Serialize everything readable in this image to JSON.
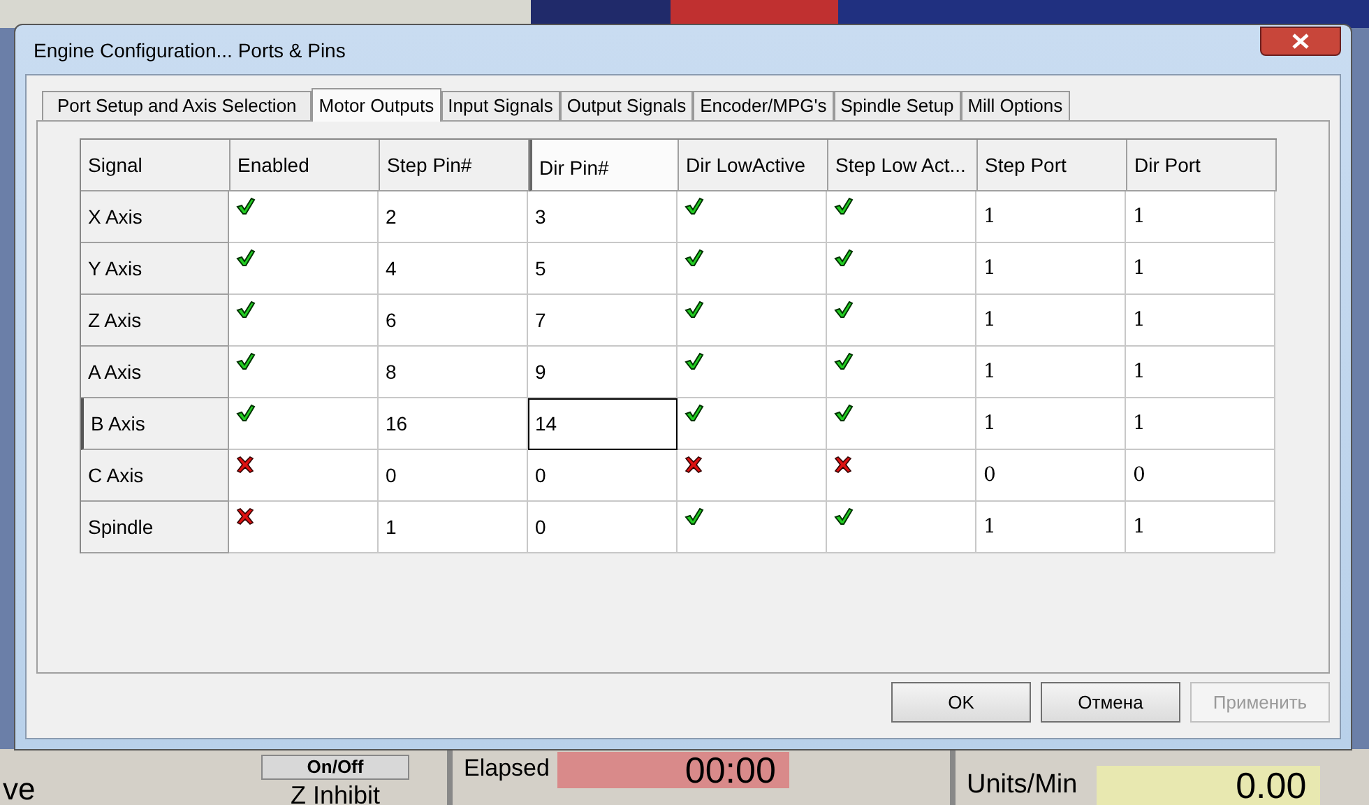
{
  "background": {
    "left_text": "ve",
    "onoff_button": "On/Off",
    "z_inhibit": "Z Inhibit",
    "elapsed_label": "Elapsed",
    "elapsed_value": "00:00",
    "units_label": "Units/Min",
    "units_value": "0.00"
  },
  "window": {
    "title": "Engine Configuration... Ports & Pins"
  },
  "tabs": [
    {
      "label": "Port Setup and Axis Selection",
      "selected": false
    },
    {
      "label": "Motor Outputs",
      "selected": true
    },
    {
      "label": "Input Signals",
      "selected": false
    },
    {
      "label": "Output Signals",
      "selected": false
    },
    {
      "label": "Encoder/MPG's",
      "selected": false
    },
    {
      "label": "Spindle Setup",
      "selected": false
    },
    {
      "label": "Mill Options",
      "selected": false
    }
  ],
  "table": {
    "columns": [
      {
        "label": "Signal",
        "selected": false
      },
      {
        "label": "Enabled",
        "selected": false
      },
      {
        "label": "Step Pin#",
        "selected": false
      },
      {
        "label": "Dir Pin#",
        "selected": true
      },
      {
        "label": "Dir LowActive",
        "selected": false
      },
      {
        "label": "Step Low Act...",
        "selected": false
      },
      {
        "label": "Step Port",
        "selected": false
      },
      {
        "label": "Dir Port",
        "selected": false
      }
    ],
    "rows": [
      {
        "signal": "X Axis",
        "enabled": true,
        "step_pin": "2",
        "dir_pin": "3",
        "dir_low_active": true,
        "step_low_active": true,
        "step_port": "1",
        "dir_port": "1",
        "selected": false
      },
      {
        "signal": "Y Axis",
        "enabled": true,
        "step_pin": "4",
        "dir_pin": "5",
        "dir_low_active": true,
        "step_low_active": true,
        "step_port": "1",
        "dir_port": "1",
        "selected": false
      },
      {
        "signal": "Z Axis",
        "enabled": true,
        "step_pin": "6",
        "dir_pin": "7",
        "dir_low_active": true,
        "step_low_active": true,
        "step_port": "1",
        "dir_port": "1",
        "selected": false
      },
      {
        "signal": "A Axis",
        "enabled": true,
        "step_pin": "8",
        "dir_pin": "9",
        "dir_low_active": true,
        "step_low_active": true,
        "step_port": "1",
        "dir_port": "1",
        "selected": false
      },
      {
        "signal": "B Axis",
        "enabled": true,
        "step_pin": "16",
        "dir_pin": "14",
        "dir_low_active": true,
        "step_low_active": true,
        "step_port": "1",
        "dir_port": "1",
        "selected": true
      },
      {
        "signal": "C Axis",
        "enabled": false,
        "step_pin": "0",
        "dir_pin": "0",
        "dir_low_active": false,
        "step_low_active": false,
        "step_port": "0",
        "dir_port": "0",
        "selected": false
      },
      {
        "signal": "Spindle",
        "enabled": false,
        "step_pin": "1",
        "dir_pin": "0",
        "dir_low_active": true,
        "step_low_active": true,
        "step_port": "1",
        "dir_port": "1",
        "selected": false
      }
    ]
  },
  "buttons": [
    {
      "label": "OK",
      "disabled": false
    },
    {
      "label": "Отмена",
      "disabled": false
    },
    {
      "label": "Применить",
      "disabled": true
    }
  ]
}
